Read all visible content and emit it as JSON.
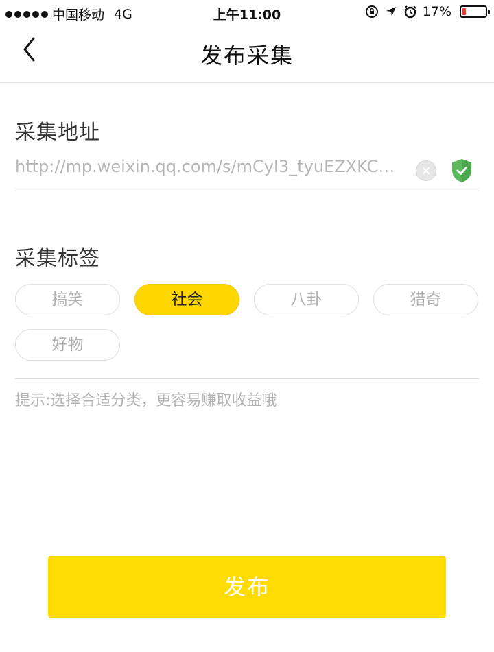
{
  "status_bar": {
    "carrier": "中国移动",
    "network": "4G",
    "time": "上午11:00",
    "battery_percent": "17%",
    "battery_level": 0.17,
    "icons": [
      "orientation-lock-icon",
      "location-arrow-icon",
      "alarm-icon",
      "battery-icon"
    ]
  },
  "nav": {
    "title": "发布采集",
    "back_icon": "chevron-left-icon"
  },
  "address_section": {
    "title": "采集地址",
    "url_value": "http://mp.weixin.qq.com/s/mCyI3_tyuEZXKCg...",
    "clear_icon": "close-circle-icon",
    "verified_icon": "shield-check-icon",
    "verified_color": "#5cb85c"
  },
  "tags_section": {
    "title": "采集标签",
    "tags": [
      {
        "label": "搞笑",
        "selected": false
      },
      {
        "label": "社会",
        "selected": true
      },
      {
        "label": "八卦",
        "selected": false
      },
      {
        "label": "猎奇",
        "selected": false
      },
      {
        "label": "好物",
        "selected": false
      }
    ],
    "hint": "提示:选择合适分类，更容易赚取收益哦"
  },
  "publish_button": {
    "label": "发布",
    "color": "#ffdb00"
  }
}
